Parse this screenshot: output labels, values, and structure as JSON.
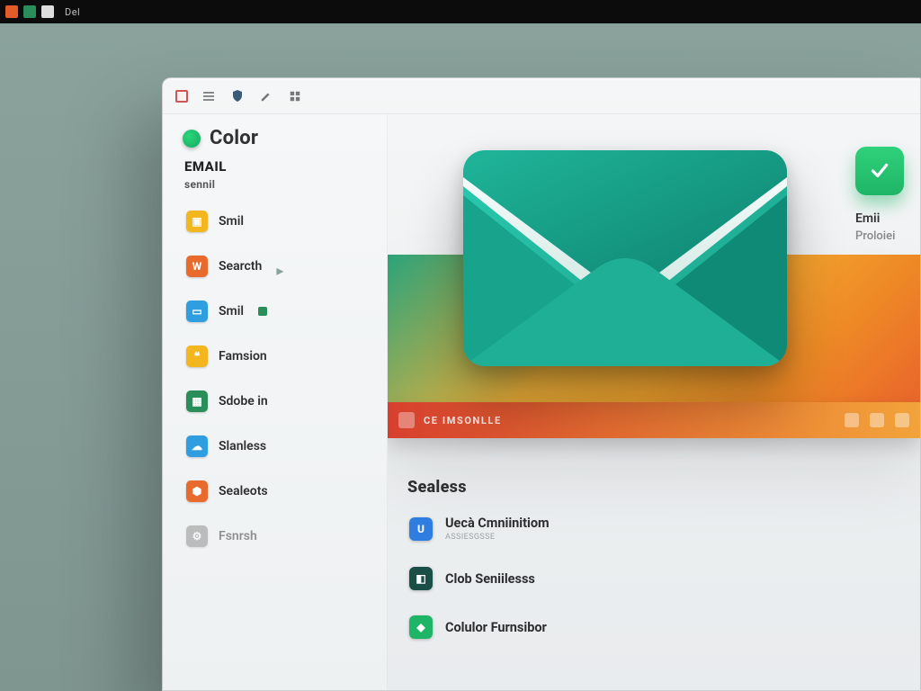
{
  "os": {
    "menu_label": "Del"
  },
  "titlebar": {},
  "sidebar": {
    "title": "Color",
    "section1": "EMAIL",
    "sub1": "sennil",
    "items": [
      {
        "label": "Smil"
      },
      {
        "label": "Searcth"
      },
      {
        "label": "Smil"
      },
      {
        "label": "Famsion"
      },
      {
        "label": "Sdobe in"
      },
      {
        "label": "Slanless"
      },
      {
        "label": "Sealeots"
      },
      {
        "label": "Fsnrsh"
      }
    ]
  },
  "top_card": {
    "line1": "Emii",
    "line2": "Proloiei"
  },
  "banner_strip": {
    "label": "CE IMSONLLE"
  },
  "section_heading": "Sealess",
  "list": [
    {
      "title": "Uecà Cmniinitiom",
      "sub": "ASSIESGSSE"
    },
    {
      "title": "Clob Seniilesss",
      "sub": ""
    },
    {
      "title": "Colulor Furnsibor",
      "sub": ""
    }
  ],
  "colors": {
    "teal": "#1fb59a",
    "orange": "#f08a2e",
    "red": "#e44d32",
    "green": "#1fb567",
    "blue": "#2f7de1",
    "yellow": "#f4b61f",
    "dgreen": "#1a4f47"
  }
}
